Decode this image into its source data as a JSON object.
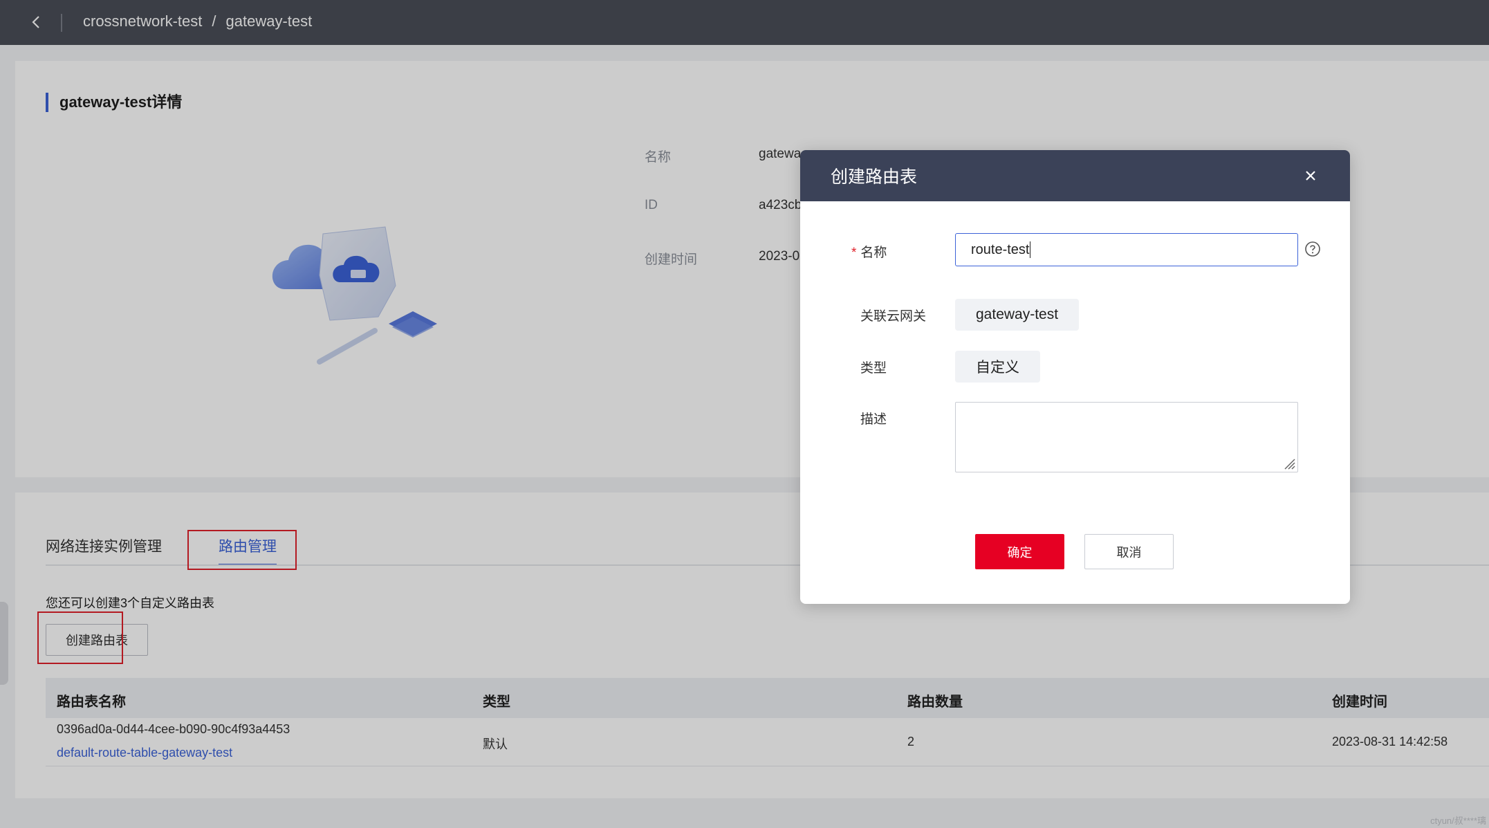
{
  "header": {
    "crumb_project": "crossnetwork-test",
    "crumb_sep": "/",
    "crumb_gateway": "gateway-test"
  },
  "detail": {
    "title": "gateway-test详情",
    "fields": [
      {
        "key": "名称",
        "value": "gatewa"
      },
      {
        "key": "ID",
        "value": "a423cb"
      },
      {
        "key": "创建时间",
        "value": "2023-0"
      }
    ]
  },
  "tabs": [
    {
      "label": "网络连接实例管理"
    },
    {
      "label": "路由管理"
    }
  ],
  "routes": {
    "hint": "您还可以创建3个自定义路由表",
    "create_button": "创建路由表",
    "columns": [
      "路由表名称",
      "类型",
      "路由数量",
      "创建时间"
    ],
    "rows": [
      {
        "id": "0396ad0a-0d44-4cee-b090-90c4f93a4453",
        "name": "default-route-table-gateway-test",
        "type": "默认",
        "count": "2",
        "created": "2023-08-31 14:42:58"
      }
    ]
  },
  "modal": {
    "title": "创建路由表",
    "required_mark": "*",
    "name_label": "名称",
    "name_value": "route-test",
    "gateway_label": "关联云网关",
    "gateway_value": "gateway-test",
    "type_label": "类型",
    "type_value": "自定义",
    "desc_label": "描述",
    "ok_label": "确定",
    "cancel_label": "取消"
  },
  "watermark": "ctyun/叔****璃",
  "colors": {
    "accent": "#3b62d8",
    "primary_button": "#e60023",
    "header_bg": "#4a4e58",
    "modal_header_bg": "#3b4258",
    "highlight_box": "#e0202a"
  }
}
